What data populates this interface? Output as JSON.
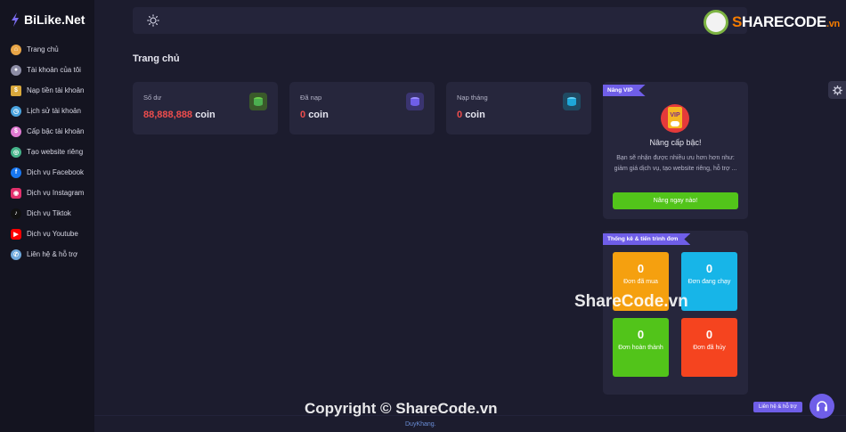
{
  "brand": {
    "name": "BiLike.Net"
  },
  "sidebar": {
    "items": [
      {
        "label": "Trang chủ",
        "icon": "home-icon",
        "color": "#e8a547"
      },
      {
        "label": "Tài khoản của tôi",
        "icon": "user-icon",
        "color": "#8d8da6"
      },
      {
        "label": "Nạp tiền tài khoản",
        "icon": "money-icon",
        "color": "#d9a83c"
      },
      {
        "label": "Lịch sử tài khoản",
        "icon": "history-icon",
        "color": "#4aa3df"
      },
      {
        "label": "Cấp bậc tài khoản",
        "icon": "rank-icon",
        "color": "#e07ad1"
      },
      {
        "label": "Tạo website riêng",
        "icon": "globe-icon",
        "color": "#45b38a"
      },
      {
        "label": "Dịch vụ Facebook",
        "icon": "facebook-icon",
        "color": "#1877f2"
      },
      {
        "label": "Dịch vụ Instagram",
        "icon": "instagram-icon",
        "color": "#e1306c"
      },
      {
        "label": "Dịch vụ Tiktok",
        "icon": "tiktok-icon",
        "color": "#111111"
      },
      {
        "label": "Dịch vụ Youtube",
        "icon": "youtube-icon",
        "color": "#ff0000"
      },
      {
        "label": "Liên hệ & hỗ trợ",
        "icon": "support-icon",
        "color": "#6fa8dc"
      }
    ]
  },
  "topbar": {
    "theme_icon": "sun-icon"
  },
  "watermark": {
    "logo_s": "S",
    "logo_text": "HARECODE",
    "logo_vn": ".vn",
    "center": "ShareCode.vn",
    "bottom": "Copyright © ShareCode.vn"
  },
  "page": {
    "title": "Trang chủ"
  },
  "stats": [
    {
      "label": "Số dư",
      "value": "88,888,888",
      "unit": "coin",
      "icon_color": "#4caf50"
    },
    {
      "label": "Đã nạp",
      "value": "0",
      "unit": "coin",
      "icon_color": "#6f5ee8"
    },
    {
      "label": "Nạp tháng",
      "value": "0",
      "unit": "coin",
      "icon_color": "#1ea7d8"
    }
  ],
  "vip": {
    "ribbon": "Nâng VIP",
    "title": "Nâng cấp bậc!",
    "description": "Bạn sẽ nhận được nhiều ưu hơn hơn như: giảm giá dịch vụ, tạo website riêng, hỗ trợ ...",
    "button": "Nâng ngay nào!",
    "badge_text": "VIP"
  },
  "orders": {
    "ribbon": "Thống kê & tiến trình đơn",
    "tiles": [
      {
        "count": "0",
        "label": "Đơn đã mua",
        "color": "#f5a00f"
      },
      {
        "count": "0",
        "label": "Đơn đang chạy",
        "color": "#17b5e8"
      },
      {
        "count": "0",
        "label": "Đơn hoàn thành",
        "color": "#52c41a"
      },
      {
        "count": "0",
        "label": "Đơn đã hủy",
        "color": "#f5441f"
      }
    ]
  },
  "footer": {
    "credit": "DuyKhang."
  },
  "help": {
    "label": "Liên hệ & hỗ trợ"
  }
}
